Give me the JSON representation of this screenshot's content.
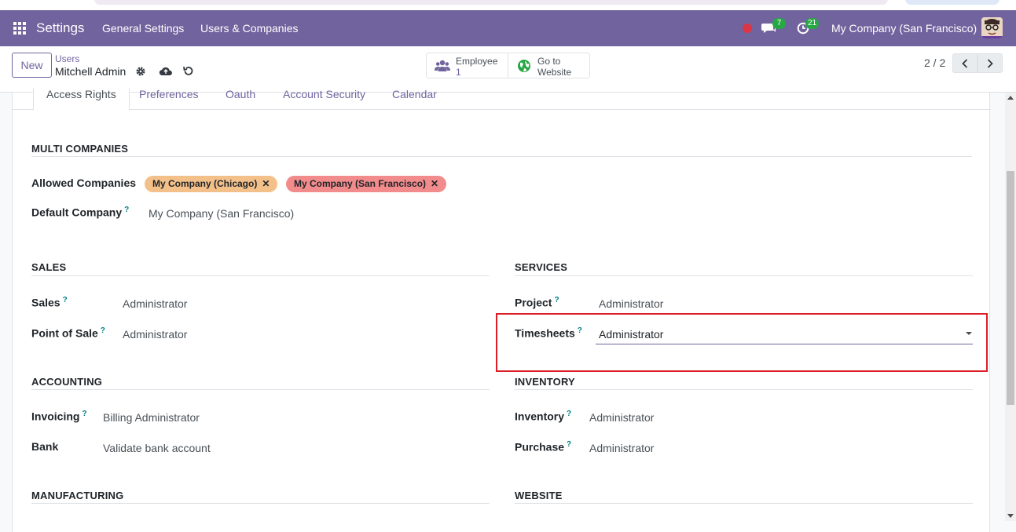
{
  "navbar": {
    "app_title": "Settings",
    "menu": [
      "General Settings",
      "Users & Companies"
    ],
    "chat_count": "7",
    "activity_count": "21",
    "company": "My Company (San Francisco)"
  },
  "control": {
    "new_label": "New",
    "breadcrumb_parent": "Users",
    "breadcrumb_current": "Mitchell Admin",
    "employee_label": "Employee",
    "employee_count": "1",
    "website_line1": "Go to",
    "website_line2": "Website",
    "pager": "2 / 2"
  },
  "tabs": [
    "Access Rights",
    "Preferences",
    "Oauth",
    "Account Security",
    "Calendar"
  ],
  "multi_companies": {
    "title": "MULTI COMPANIES",
    "allowed_label": "Allowed Companies",
    "allowed": [
      "My Company (Chicago)",
      "My Company (San Francisco)"
    ],
    "default_label": "Default Company",
    "default_value": "My Company (San Francisco)"
  },
  "sales": {
    "title": "SALES",
    "fields": [
      {
        "label": "Sales",
        "value": "Administrator"
      },
      {
        "label": "Point of Sale",
        "value": "Administrator"
      }
    ]
  },
  "services": {
    "title": "SERVICES",
    "fields": [
      {
        "label": "Project",
        "value": "Administrator"
      },
      {
        "label": "Timesheets",
        "value": "Administrator"
      }
    ]
  },
  "accounting": {
    "title": "ACCOUNTING",
    "fields": [
      {
        "label": "Invoicing",
        "value": "Billing Administrator"
      },
      {
        "label": "Bank",
        "value": "Validate bank account"
      }
    ]
  },
  "inventory": {
    "title": "INVENTORY",
    "fields": [
      {
        "label": "Inventory",
        "value": "Administrator"
      },
      {
        "label": "Purchase",
        "value": "Administrator"
      }
    ]
  },
  "manufacturing": {
    "title": "MANUFACTURING"
  },
  "website": {
    "title": "WEBSITE"
  },
  "help_mark": "?",
  "tag_remove": "✕",
  "colors": {
    "brand": "#71639e",
    "tag_chicago": "#f4c08a",
    "tag_sf": "#f28b8b",
    "highlight": "#dc1f26",
    "badge": "#28a745"
  }
}
